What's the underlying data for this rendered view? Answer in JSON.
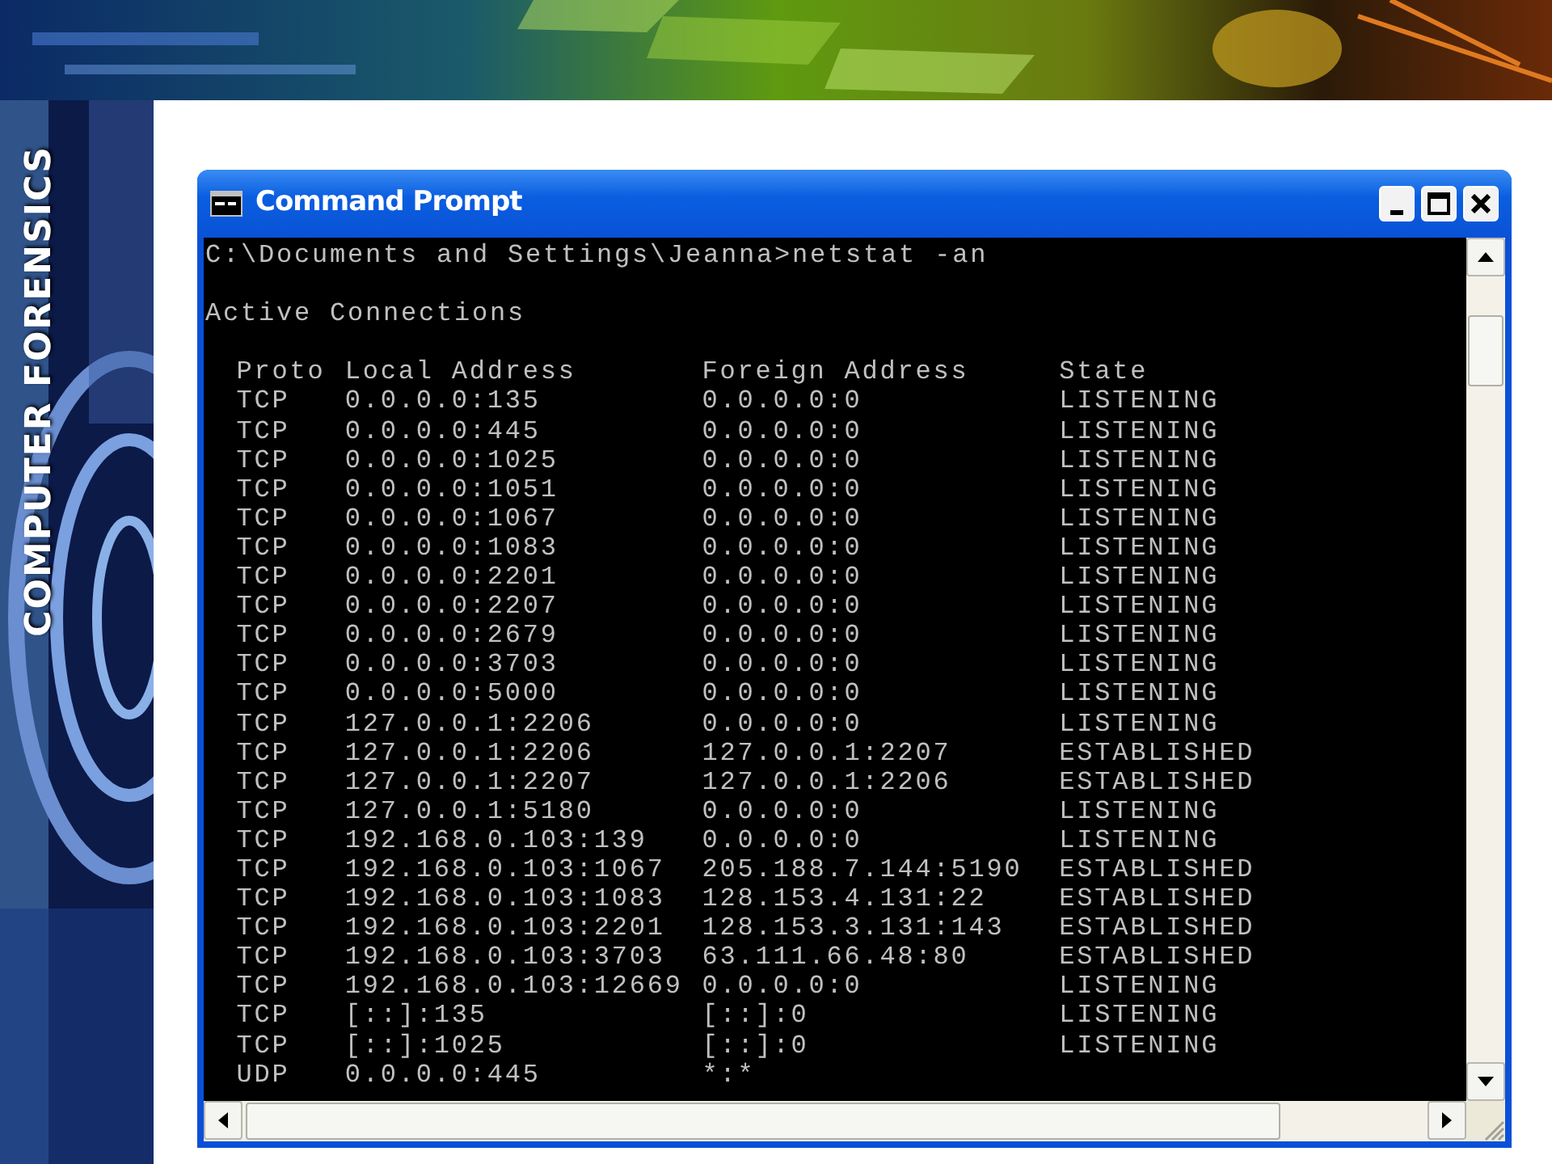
{
  "slide": {
    "side_title": "COMPUTER FORENSICS"
  },
  "window": {
    "title": "Command Prompt"
  },
  "console": {
    "command_line": "C:\\Documents and Settings\\Jeanna>netstat -an",
    "heading": "Active Connections",
    "columns": [
      "Proto",
      "Local Address",
      "Foreign Address",
      "State"
    ],
    "rows": [
      {
        "proto": "TCP",
        "local": "0.0.0.0:135",
        "foreign": "0.0.0.0:0",
        "state": "LISTENING"
      },
      {
        "proto": "TCP",
        "local": "0.0.0.0:445",
        "foreign": "0.0.0.0:0",
        "state": "LISTENING"
      },
      {
        "proto": "TCP",
        "local": "0.0.0.0:1025",
        "foreign": "0.0.0.0:0",
        "state": "LISTENING"
      },
      {
        "proto": "TCP",
        "local": "0.0.0.0:1051",
        "foreign": "0.0.0.0:0",
        "state": "LISTENING"
      },
      {
        "proto": "TCP",
        "local": "0.0.0.0:1067",
        "foreign": "0.0.0.0:0",
        "state": "LISTENING"
      },
      {
        "proto": "TCP",
        "local": "0.0.0.0:1083",
        "foreign": "0.0.0.0:0",
        "state": "LISTENING"
      },
      {
        "proto": "TCP",
        "local": "0.0.0.0:2201",
        "foreign": "0.0.0.0:0",
        "state": "LISTENING"
      },
      {
        "proto": "TCP",
        "local": "0.0.0.0:2207",
        "foreign": "0.0.0.0:0",
        "state": "LISTENING"
      },
      {
        "proto": "TCP",
        "local": "0.0.0.0:2679",
        "foreign": "0.0.0.0:0",
        "state": "LISTENING"
      },
      {
        "proto": "TCP",
        "local": "0.0.0.0:3703",
        "foreign": "0.0.0.0:0",
        "state": "LISTENING"
      },
      {
        "proto": "TCP",
        "local": "0.0.0.0:5000",
        "foreign": "0.0.0.0:0",
        "state": "LISTENING"
      },
      {
        "proto": "TCP",
        "local": "127.0.0.1:2206",
        "foreign": "0.0.0.0:0",
        "state": "LISTENING"
      },
      {
        "proto": "TCP",
        "local": "127.0.0.1:2206",
        "foreign": "127.0.0.1:2207",
        "state": "ESTABLISHED"
      },
      {
        "proto": "TCP",
        "local": "127.0.0.1:2207",
        "foreign": "127.0.0.1:2206",
        "state": "ESTABLISHED"
      },
      {
        "proto": "TCP",
        "local": "127.0.0.1:5180",
        "foreign": "0.0.0.0:0",
        "state": "LISTENING"
      },
      {
        "proto": "TCP",
        "local": "192.168.0.103:139",
        "foreign": "0.0.0.0:0",
        "state": "LISTENING"
      },
      {
        "proto": "TCP",
        "local": "192.168.0.103:1067",
        "foreign": "205.188.7.144:5190",
        "state": "ESTABLISHED"
      },
      {
        "proto": "TCP",
        "local": "192.168.0.103:1083",
        "foreign": "128.153.4.131:22",
        "state": "ESTABLISHED"
      },
      {
        "proto": "TCP",
        "local": "192.168.0.103:2201",
        "foreign": "128.153.3.131:143",
        "state": "ESTABLISHED"
      },
      {
        "proto": "TCP",
        "local": "192.168.0.103:3703",
        "foreign": "63.111.66.48:80",
        "state": "ESTABLISHED"
      },
      {
        "proto": "TCP",
        "local": "192.168.0.103:12669",
        "foreign": "0.0.0.0:0",
        "state": "LISTENING"
      },
      {
        "proto": "TCP",
        "local": "[::]:135",
        "foreign": "[::]:0",
        "state": "LISTENING"
      },
      {
        "proto": "TCP",
        "local": "[::]:1025",
        "foreign": "[::]:0",
        "state": "LISTENING"
      },
      {
        "proto": "UDP",
        "local": "0.0.0.0:445",
        "foreign": "*:*",
        "state": ""
      }
    ]
  }
}
